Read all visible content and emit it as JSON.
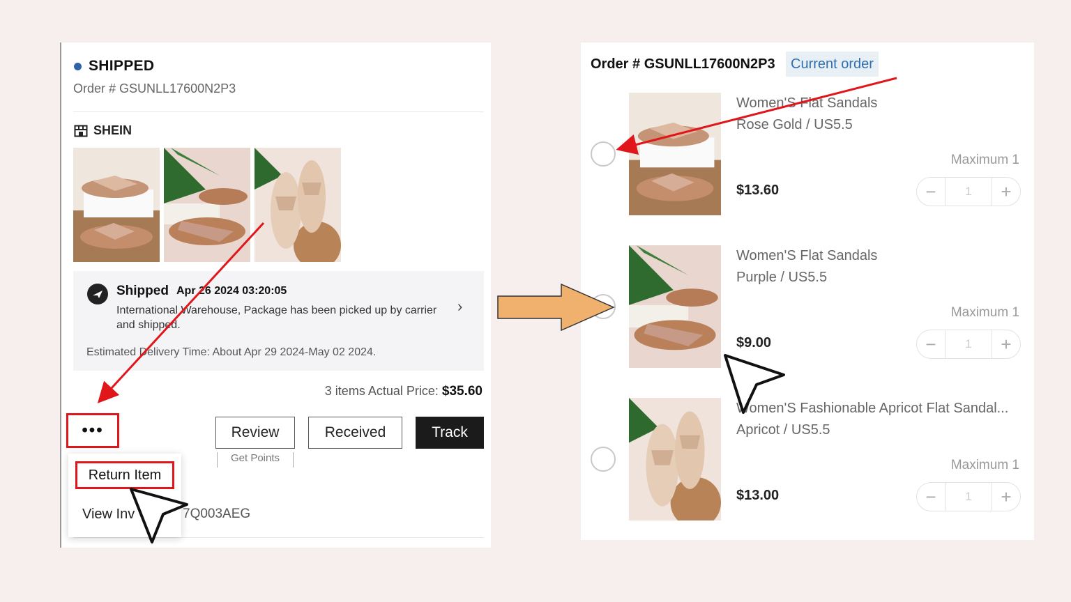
{
  "left": {
    "status": "SHIPPED",
    "order_label": "Order #  GSUNLL17600N2P3",
    "store": "SHEIN",
    "shipment": {
      "title": "Shipped",
      "date": "Apr 26 2024 03:20:05",
      "description": "International Warehouse, Package has been picked up by carrier and shipped.",
      "eta": "Estimated Delivery Time: About Apr 29 2024-May 02 2024."
    },
    "price_prefix": "3 items Actual Price: ",
    "price_value": "$35.60",
    "more_label": "•••",
    "buttons": {
      "review": "Review",
      "received": "Received",
      "track": "Track"
    },
    "get_points": "Get Points",
    "menu": {
      "return_item": "Return Item",
      "view_invoice": "View Inv"
    },
    "invoice_tail": "7Q003AEG"
  },
  "right": {
    "order_label": "Order # GSUNLL17600N2P3",
    "badge": "Current order",
    "items": [
      {
        "name": "Women'S Flat Sandals",
        "variant": "Rose Gold / US5.5",
        "max": "Maximum 1",
        "price": "$13.60",
        "qty": "1"
      },
      {
        "name": "Women'S Flat Sandals",
        "variant": "Purple / US5.5",
        "max": "Maximum 1",
        "price": "$9.00",
        "qty": "1"
      },
      {
        "name": "Women'S Fashionable Apricot Flat Sandal...",
        "variant": "Apricot / US5.5",
        "max": "Maximum 1",
        "price": "$13.00",
        "qty": "1"
      }
    ]
  },
  "colors": {
    "accent_blue": "#2f63a8",
    "highlight_red": "#e0161b",
    "arrow_orange": "#f0b06e",
    "badge_bg": "#e8f0f6"
  }
}
